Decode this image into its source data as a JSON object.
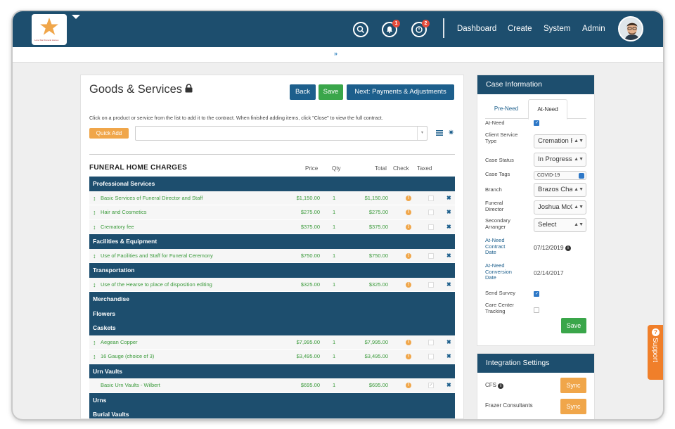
{
  "brand": {
    "logo_text": "Lone Star Funeral Homes"
  },
  "nav": {
    "notifications_count": "1",
    "activity_count": "2",
    "links": [
      "Dashboard",
      "Create",
      "System",
      "Admin"
    ]
  },
  "goods": {
    "title": "Goods & Services",
    "back_label": "Back",
    "save_label": "Save",
    "next_label": "Next: Payments & Adjustments",
    "instructions": "Click on a product or service from the list to add it to the contract. When finished adding items, click \"Close\" to view the full contract.",
    "quick_add_label": "Quick Add",
    "section_title": "FUNERAL HOME CHARGES",
    "columns": {
      "price": "Price",
      "qty": "Qty",
      "total": "Total",
      "check": "Check",
      "taxed": "Taxed"
    }
  },
  "categories": [
    {
      "name": "Professional Services",
      "items": [
        {
          "name": "Basic Services of Funeral Director and Staff",
          "price": "$1,150.00",
          "qty": "1",
          "total": "$1,150.00",
          "taxed": false
        },
        {
          "name": "Hair and Cosmetics",
          "price": "$275.00",
          "qty": "1",
          "total": "$275.00",
          "taxed": false
        },
        {
          "name": "Crematory fee",
          "price": "$375.00",
          "qty": "1",
          "total": "$375.00",
          "taxed": false
        }
      ]
    },
    {
      "name": "Facilities & Equipment",
      "items": [
        {
          "name": "Use of Facilities and Staff for Funeral Ceremony",
          "price": "$750.00",
          "qty": "1",
          "total": "$750.00",
          "taxed": false
        }
      ]
    },
    {
      "name": "Transportation",
      "items": [
        {
          "name": "Use of the Hearse to place of disposition editing",
          "price": "$325.00",
          "qty": "1",
          "total": "$325.00",
          "taxed": false
        }
      ]
    },
    {
      "name": "Merchandise",
      "items": []
    },
    {
      "name": "Flowers",
      "items": []
    },
    {
      "name": "Caskets",
      "items": [
        {
          "name": "Aegean Copper",
          "price": "$7,995.00",
          "qty": "1",
          "total": "$7,995.00",
          "taxed": false
        },
        {
          "name": "16 Gauge (choice of 3)",
          "price": "$3,495.00",
          "qty": "1",
          "total": "$3,495.00",
          "taxed": false
        }
      ]
    },
    {
      "name": "Urn Vaults",
      "items": [
        {
          "name": "Basic Urn Vaults - Wilbert",
          "price": "$695.00",
          "qty": "1",
          "total": "$695.00",
          "taxed": true,
          "no_drag": true
        }
      ]
    },
    {
      "name": "Urns",
      "items": []
    },
    {
      "name": "Burial Vaults",
      "items": []
    }
  ],
  "case_info": {
    "title": "Case Information",
    "tab_preneed": "Pre-Need",
    "tab_atneed": "At-Need",
    "at_need_label": "At-Need",
    "service_type_label": "Client Service Type",
    "service_type_value": "Cremation F",
    "status_label": "Case Status",
    "status_value": "In Progress",
    "tags_label": "Case Tags",
    "tags_value": "COVID-19",
    "branch_label": "Branch",
    "branch_value": "Brazos Chap",
    "director_label": "Funeral Director",
    "director_value": "Joshua McQ",
    "arranger_label": "Secondary Arranger",
    "arranger_value": "Select",
    "contract_date_label": "At-Need Contract Date",
    "contract_date_value": "07/12/2019",
    "conversion_date_label": "At-Need Conversion Date",
    "conversion_date_value": "02/14/2017",
    "send_survey_label": "Send Survey",
    "care_center_label": "Care Center Tracking",
    "save_label": "Save"
  },
  "integration": {
    "title": "Integration Settings",
    "cfs_label": "CFS",
    "frazer_label": "Frazer Consultants",
    "sync_label": "Sync"
  },
  "support_label": "Support"
}
